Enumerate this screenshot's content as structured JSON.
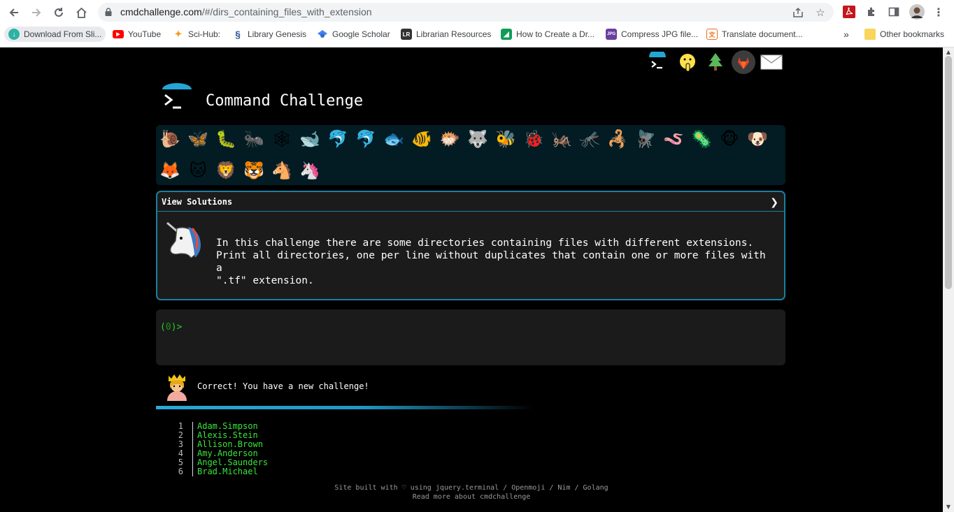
{
  "browser": {
    "url_host": "cmdchallenge.com",
    "url_path": "/#/dirs_containing_files_with_extension",
    "bookmarks": [
      {
        "label": "Download From Sli...",
        "icon": "download-app-icon",
        "color": "#2bb3a3"
      },
      {
        "label": "YouTube",
        "icon": "youtube-icon",
        "color": "#ff0000"
      },
      {
        "label": "Sci-Hub:",
        "icon": "scihub-icon",
        "color": "#f29b1d"
      },
      {
        "label": "Library Genesis",
        "icon": "library-genesis-icon",
        "color": "#2b5797"
      },
      {
        "label": "Google Scholar",
        "icon": "google-scholar-icon",
        "color": "#4285f4"
      },
      {
        "label": "Librarian Resources",
        "icon": "librarian-resources-icon",
        "color": "#333333"
      },
      {
        "label": "How to Create a Dr...",
        "icon": "sheets-icon",
        "color": "#0f9d58"
      },
      {
        "label": "Compress JPG file...",
        "icon": "jpg-icon",
        "color": "#6a3fa0"
      },
      {
        "label": "Translate document...",
        "icon": "translate-icon",
        "color": "#e8711a"
      }
    ],
    "overflow_label": "»",
    "other_bookmarks": "Other bookmarks"
  },
  "site": {
    "title": "Command Challenge",
    "top_icons": [
      "terminal-logo-icon",
      "shushing-face-icon",
      "tree-icon",
      "gitlab-icon",
      "envelope-icon"
    ],
    "animals": [
      "🐌",
      "🦋",
      "🐛",
      "🐜",
      "🕸",
      "🐋",
      "🐬",
      "🐬",
      "🐟",
      "🐠",
      "🐡",
      "🐺",
      "🐝",
      "🐞",
      "🦗",
      "🦟",
      "🦂",
      "🪰",
      "🪱",
      "🦠",
      "🐵",
      "🐶",
      "🦊",
      "🐱",
      "🦁",
      "🐯",
      "🐴",
      "🦄"
    ],
    "view_solutions": "View Solutions",
    "chevron": "❯",
    "description": "In this challenge there are some directories containing files with different extensions.\nPrint all directories, one per line without duplicates that contain one or more files with a\n\".tf\" extension.",
    "prompt_zero": "0",
    "correct_message": "Correct! You have a new challenge!",
    "output_lines": [
      {
        "num": "1",
        "text": "Adam.Simpson"
      },
      {
        "num": "2",
        "text": "Alexis.Stein"
      },
      {
        "num": "3",
        "text": "Allison.Brown"
      },
      {
        "num": "4",
        "text": "Amy.Anderson"
      },
      {
        "num": "5",
        "text": "Angel.Saunders"
      },
      {
        "num": "6",
        "text": "Brad.Michael"
      }
    ],
    "footer_line1": "Site built with ♡ using jquery.terminal / Openmoji / Nim / Golang",
    "footer_line2": "Read more about cmdchallenge"
  },
  "colors": {
    "accent": "#1c7ea0",
    "prompt_green": "#2ecc2e",
    "output_green": "#39e639"
  }
}
